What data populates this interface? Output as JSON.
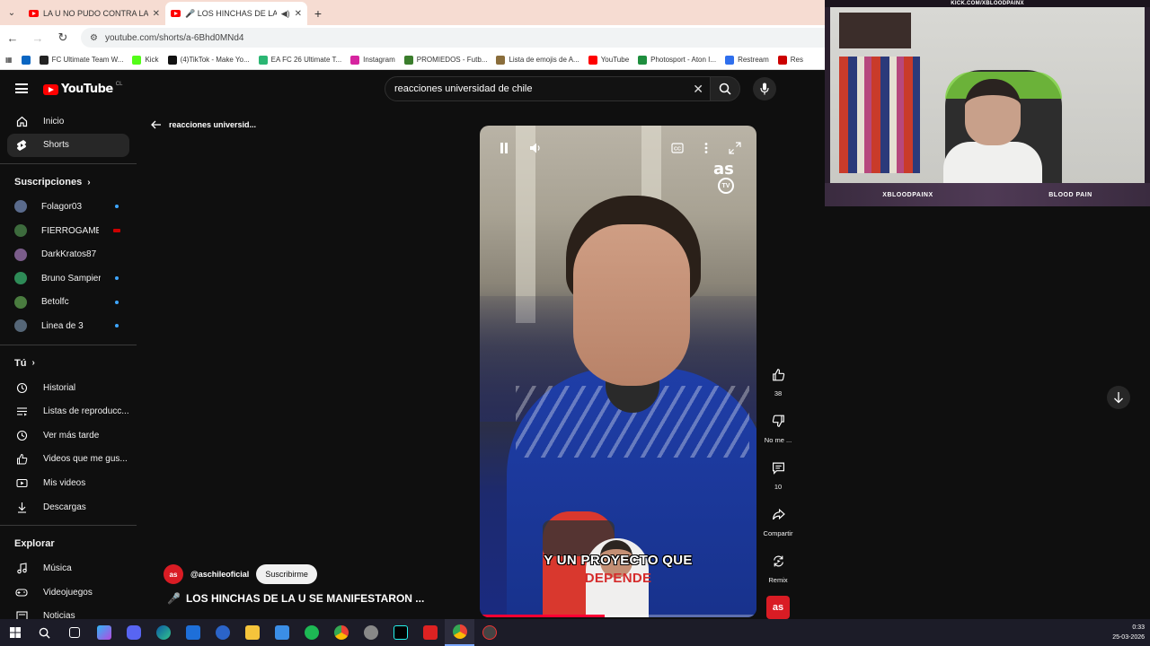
{
  "browser": {
    "tabs": [
      {
        "title": "LA U NO PUDO CONTRA LA CA",
        "active": false
      },
      {
        "title": "🎤 LOS HINCHAS DE LA U",
        "active": true
      }
    ],
    "new_tab": "+",
    "url": "youtube.com/shorts/a-6Bhd0MNd4",
    "bookmarks": [
      {
        "label": "",
        "color": "#0a66c2"
      },
      {
        "label": "FC Ultimate Team W...",
        "color": "#222222"
      },
      {
        "label": "Kick",
        "color": "#53fc18"
      },
      {
        "label": "(4)TikTok - Make Yo...",
        "color": "#111111"
      },
      {
        "label": "EA FC 26 Ultimate T...",
        "color": "#2bb673"
      },
      {
        "label": "Instagram",
        "color": "#d6249f"
      },
      {
        "label": "PROMIEDOS - Futb...",
        "color": "#3a7d2c"
      },
      {
        "label": "Lista de emojis de A...",
        "color": "#8a6d3b"
      },
      {
        "label": "YouTube",
        "color": "#ff0000"
      },
      {
        "label": "Photosport - Aton I...",
        "color": "#1e8e3e"
      },
      {
        "label": "Restream",
        "color": "#2f6fed"
      },
      {
        "label": "Res",
        "color": "#cc0000"
      }
    ]
  },
  "youtube": {
    "logo_text": "YouTube",
    "logo_country": "CL",
    "search_query": "reacciones universidad de chile"
  },
  "sidebar": {
    "main": [
      {
        "label": "Inicio",
        "icon": "home-icon",
        "selected": false
      },
      {
        "label": "Shorts",
        "icon": "shorts-icon",
        "selected": true
      }
    ],
    "subs_header": "Suscripciones",
    "subscriptions": [
      {
        "label": "Folagor03",
        "color": "#5a6b8c",
        "indicator": "dot"
      },
      {
        "label": "FIERROGAMER",
        "color": "#3d6b3d",
        "indicator": "live"
      },
      {
        "label": "DarkKratos87",
        "color": "#7a5c8a",
        "indicator": "none"
      },
      {
        "label": "Bruno Sampieri",
        "color": "#2e8b57",
        "indicator": "dot"
      },
      {
        "label": "Betolfc",
        "color": "#4a7c3f",
        "indicator": "dot"
      },
      {
        "label": "Linea de 3",
        "color": "#556677",
        "indicator": "dot"
      }
    ],
    "you_header": "Tú",
    "you": [
      {
        "label": "Historial",
        "icon": "history-icon"
      },
      {
        "label": "Listas de reproducc...",
        "icon": "playlists-icon"
      },
      {
        "label": "Ver más tarde",
        "icon": "watch-later-icon"
      },
      {
        "label": "Videos que me gus...",
        "icon": "liked-icon"
      },
      {
        "label": "Mis videos",
        "icon": "my-videos-icon"
      },
      {
        "label": "Descargas",
        "icon": "downloads-icon"
      }
    ],
    "explore_header": "Explorar",
    "explore": [
      {
        "label": "Música",
        "icon": "music-icon"
      },
      {
        "label": "Videojuegos",
        "icon": "gaming-icon"
      },
      {
        "label": "Noticias",
        "icon": "news-icon"
      }
    ]
  },
  "shorts": {
    "back_label": "reacciones universid...",
    "subtitle_line1": "Y UN PROYECTO QUE",
    "subtitle_line2": "DEPENDE",
    "as_logo": "as",
    "as_tv": "TV",
    "progress_fraction": 0.45,
    "actions": {
      "likes": "38",
      "dislike_label": "No me ...",
      "comments": "10",
      "share_label": "Compartir",
      "remix_label": "Remix",
      "channel_badge": "as"
    },
    "channel_avatar": "as",
    "channel_name": "@aschileoficial",
    "subscribe_label": "Suscribirme",
    "title_emoji": "🎤",
    "title": "LOS HINCHAS DE LA U SE MANIFESTARON ..."
  },
  "webcam": {
    "top_text": "KICK.COM/XBLOODPAINX",
    "bottom_left": "XBLOODPAINX",
    "bottom_right": "BLOOD PAIN"
  },
  "taskbar": {
    "time": "0:33",
    "date": "25-03-2026"
  }
}
